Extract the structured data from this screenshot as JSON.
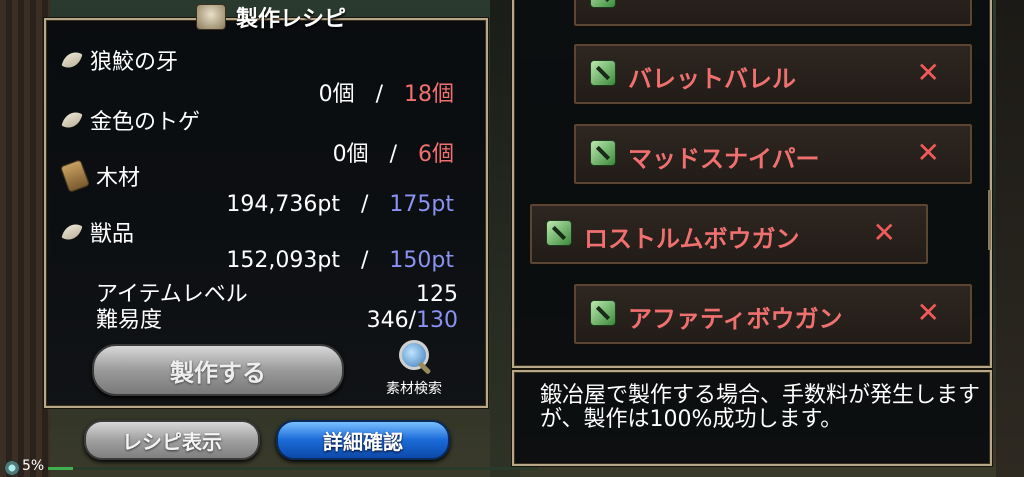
{
  "recipe": {
    "title": "製作レシピ",
    "materials": [
      {
        "name": "狼鮫の牙",
        "owned": "0個",
        "separator": "/",
        "required": "18個",
        "required_color": "#f07070"
      },
      {
        "name": "金色のトゲ",
        "owned": "0個",
        "separator": "/",
        "required": "6個",
        "required_color": "#f07070"
      },
      {
        "name": "木材",
        "owned": "194,736pt",
        "separator": "/",
        "required": "175pt",
        "required_color": "#8a92f2"
      },
      {
        "name": "獣品",
        "owned": "152,093pt",
        "separator": "/",
        "required": "150pt",
        "required_color": "#8a92f2"
      }
    ],
    "item_level_label": "アイテムレベル",
    "item_level_value": "125",
    "difficulty_label": "難易度",
    "difficulty_value": "346",
    "difficulty_sep": "/",
    "difficulty_max": "130",
    "craft_button": "製作する",
    "search_label": "素材検索"
  },
  "buttons": {
    "recipe_view": "レシピ表示",
    "details": "詳細確認"
  },
  "status": {
    "percent": "5%",
    "progress": 0.05
  },
  "recipe_list": {
    "items": [
      {
        "name": "バレットバレル",
        "mark": "✕"
      },
      {
        "name": "マッドスナイパー",
        "mark": "✕"
      },
      {
        "name": "ロストルムボウガン",
        "mark": "✕",
        "selected": true
      },
      {
        "name": "アファティボウガン",
        "mark": "✕"
      }
    ]
  },
  "message": "鍛冶屋で製作する場合、手数料が発生しますが、製作は100%成功します。"
}
